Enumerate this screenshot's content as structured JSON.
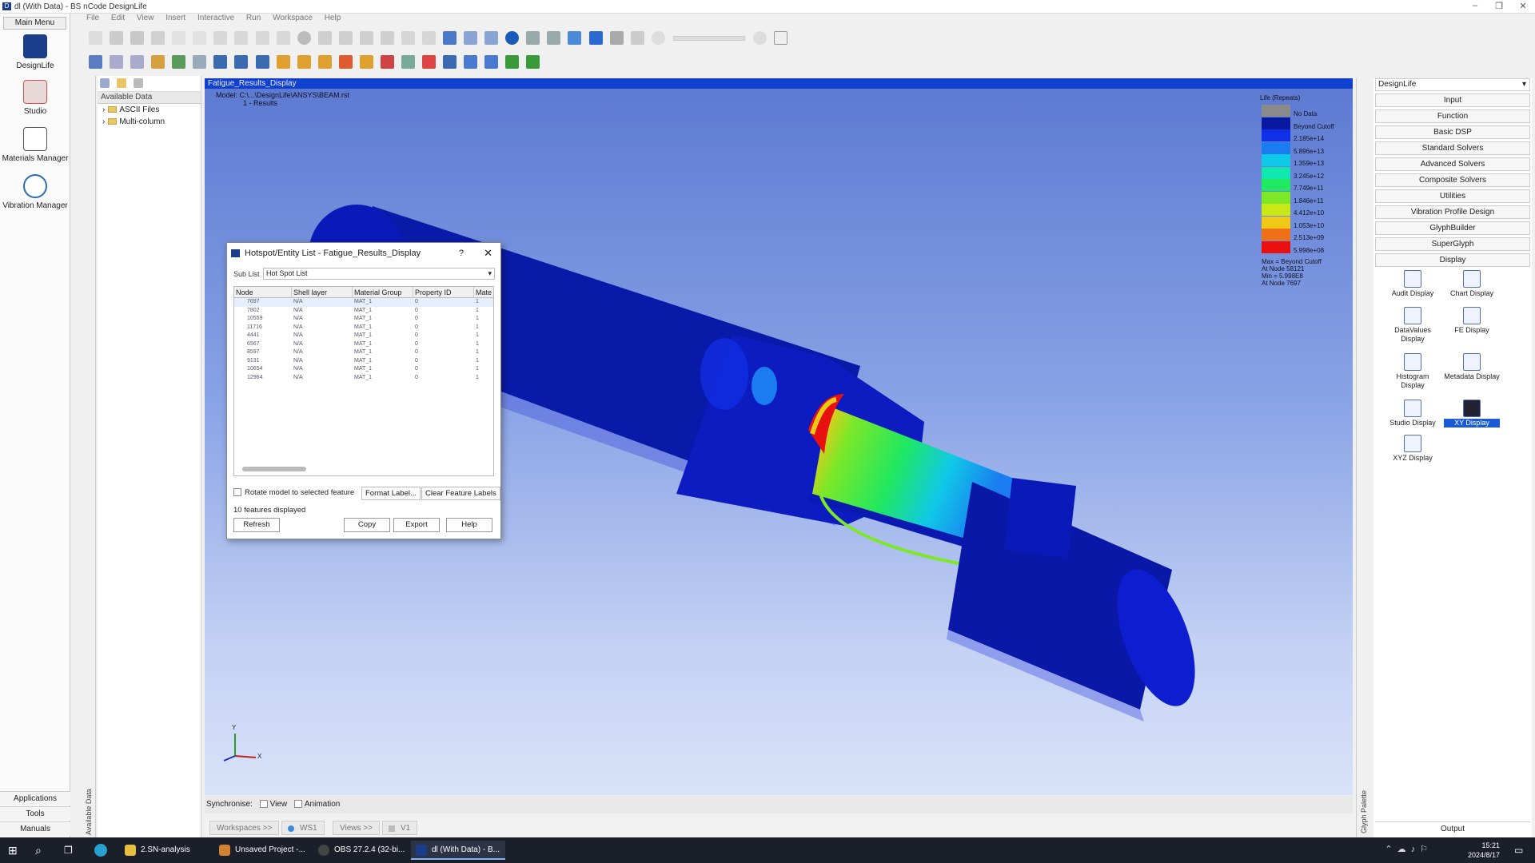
{
  "window": {
    "title": "dl (With Data) - BS nCode DesignLife",
    "controls": [
      "–",
      "❐",
      "✕"
    ]
  },
  "main_menu": {
    "header": "Main Menu",
    "apps": [
      {
        "label": "DesignLife",
        "icon": "designlife-icon",
        "color": "#1a3e8c"
      },
      {
        "label": "Studio",
        "icon": "studio-icon",
        "color": "#d05050"
      },
      {
        "label": "Materials Manager",
        "icon": "materials-manager-icon",
        "color": "#555555"
      },
      {
        "label": "Vibration Manager",
        "icon": "vibration-manager-icon",
        "color": "#2a6db5"
      }
    ],
    "bottom": [
      "Applications",
      "Tools",
      "Manuals"
    ]
  },
  "menubar": [
    "File",
    "Edit",
    "View",
    "Insert",
    "Interactive",
    "Run",
    "Workspace",
    "Help"
  ],
  "data_panel": {
    "header": "Available Data",
    "items": [
      {
        "label": "ASCII Files"
      },
      {
        "label": "Multi-column"
      }
    ],
    "side_label": "Available Data"
  },
  "viewport": {
    "title": "Fatigue_Results_Display",
    "model_line": "Model: C:\\...\\DesignLife\\ANSYS\\BEAM.rst",
    "results_line": "1 - Results",
    "legend": {
      "title": "Life (Repeats)",
      "entries": [
        {
          "label": "No Data",
          "color": "#8a8a8a"
        },
        {
          "label": "Beyond Cutoff",
          "color": "#0a1aa0"
        },
        {
          "label": "2.185e+14",
          "color": "#1030e8"
        },
        {
          "label": "5.896e+13",
          "color": "#1a7cf0"
        },
        {
          "label": "1.359e+13",
          "color": "#10c8e8"
        },
        {
          "label": "3.245e+12",
          "color": "#10e8b0"
        },
        {
          "label": "7.749e+11",
          "color": "#20e860"
        },
        {
          "label": "1.846e+11",
          "color": "#7ce828"
        },
        {
          "label": "4.412e+10",
          "color": "#c8e818"
        },
        {
          "label": "1.053e+10",
          "color": "#f0c818"
        },
        {
          "label": "2.513e+09",
          "color": "#f07018"
        },
        {
          "label": "5.998e+08",
          "color": "#e81010"
        }
      ],
      "footer": [
        "Max = Beyond Cutoff",
        "At Node 58121",
        "Min = 5.998E8",
        "At Node 7697"
      ]
    },
    "axis_labels": {
      "y": "Y",
      "x": "X"
    }
  },
  "sync_bar": {
    "label": "Synchronise:",
    "options": [
      "View",
      "Animation"
    ]
  },
  "workspace_bar": {
    "tabs": [
      "Workspaces >>",
      "WS1",
      "Views >>",
      "V1"
    ]
  },
  "glyph_palette": {
    "selector": "DesignLife",
    "categories": [
      "Input",
      "Function",
      "Basic DSP",
      "Standard Solvers",
      "Advanced Solvers",
      "Composite Solvers",
      "Utilities",
      "Vibration Profile Design",
      "GlyphBuilder",
      "SuperGlyph",
      "Display"
    ],
    "glyphs": [
      "Audit Display",
      "Chart Display",
      "DataValues Display",
      "FE Display",
      "Histogram Display",
      "Metadata Display",
      "Studio Display",
      "XY Display",
      "XYZ Display"
    ],
    "side_label": "Glyph Palette",
    "output_label": "Output"
  },
  "dialog": {
    "title": "Hotspot/Entity List - Fatigue_Results_Display",
    "help": "?",
    "close": "✕",
    "sublist_label": "Sub List",
    "sublist_value": "Hot Spot List",
    "columns": [
      "Node",
      "Shell layer",
      "Material Group",
      "Property ID",
      "Mate"
    ],
    "rows": [
      [
        "7697",
        "N/A",
        "MAT_1",
        "0",
        "1"
      ],
      [
        "7802",
        "N/A",
        "MAT_1",
        "0",
        "1"
      ],
      [
        "10559",
        "N/A",
        "MAT_1",
        "0",
        "1"
      ],
      [
        "11716",
        "N/A",
        "MAT_1",
        "0",
        "1"
      ],
      [
        "4441",
        "N/A",
        "MAT_1",
        "0",
        "1"
      ],
      [
        "6567",
        "N/A",
        "MAT_1",
        "0",
        "1"
      ],
      [
        "8597",
        "N/A",
        "MAT_1",
        "0",
        "1"
      ],
      [
        "9131",
        "N/A",
        "MAT_1",
        "0",
        "1"
      ],
      [
        "10654",
        "N/A",
        "MAT_1",
        "0",
        "1"
      ],
      [
        "12964",
        "N/A",
        "MAT_1",
        "0",
        "1"
      ]
    ],
    "rotate_label": "Rotate model to selected feature",
    "format_label": "Format Label...",
    "clear_label": "Clear Feature Labels",
    "count_text": "10 features displayed",
    "buttons": [
      "Refresh",
      "Copy",
      "Export",
      "Help"
    ]
  },
  "taskbar": {
    "apps": [
      "2.SN-analysis",
      "Unsaved Project -...",
      "OBS 27.2.4 (32-bi...",
      "dl (With Data) - B..."
    ],
    "time": "15:21",
    "date": "2024/8/17"
  }
}
